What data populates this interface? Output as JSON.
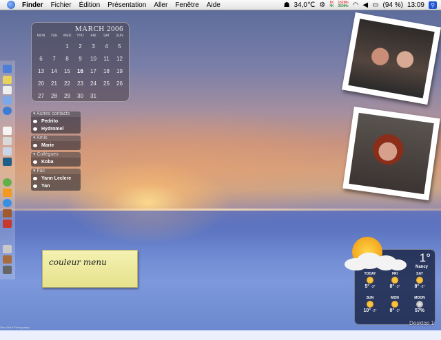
{
  "menubar": {
    "items": [
      "Finder",
      "Fichier",
      "Édition",
      "Présentation",
      "Aller",
      "Fenêtre",
      "Aide"
    ],
    "temperature": "34,0℃",
    "net_up": "1K",
    "net_down": "4K",
    "mem_up": "162Mo",
    "mem_down": "350Mo",
    "battery": "(94 %)",
    "clock": "13:09"
  },
  "calendar": {
    "month": "MARCH 2006",
    "weekdays": [
      "MON",
      "TUE",
      "WED",
      "THU",
      "FRI",
      "SAT",
      "SUN"
    ],
    "today": "16",
    "weeks": [
      [
        "",
        "",
        "1",
        "2",
        "3",
        "4",
        "5"
      ],
      [
        "6",
        "7",
        "8",
        "9",
        "10",
        "11",
        "12"
      ],
      [
        "13",
        "14",
        "15",
        "16",
        "17",
        "18",
        "19"
      ],
      [
        "20",
        "21",
        "22",
        "23",
        "24",
        "25",
        "26"
      ],
      [
        "27",
        "28",
        "29",
        "30",
        "31",
        "",
        ""
      ]
    ]
  },
  "contacts": {
    "groups": [
      {
        "name": "Autres contacts",
        "members": [
          "Pedrito",
          "Hydromel"
        ]
      },
      {
        "name": "Amis",
        "members": [
          "Marie"
        ]
      },
      {
        "name": "Collègues",
        "members": [
          "Koba"
        ]
      },
      {
        "name": "Fac",
        "members": [
          "Yann Leclere",
          "Yan"
        ]
      }
    ]
  },
  "sticky": {
    "text": "couleur menu"
  },
  "weather": {
    "temperature": "1°",
    "city": "Nancy",
    "row1": [
      {
        "day": "TODAY",
        "high": "5°",
        "low": "-3°"
      },
      {
        "day": "FRI",
        "high": "8°",
        "low": "-3°"
      },
      {
        "day": "SAT",
        "high": "8°",
        "low": "-2°"
      }
    ],
    "row2": [
      {
        "day": "SUN",
        "high": "10°",
        "low": "-2°"
      },
      {
        "day": "MON",
        "high": "8°",
        "low": "-2°"
      },
      {
        "day": "MOON",
        "high": "57%",
        "low": ""
      }
    ]
  },
  "desktop": {
    "label": "Desktop 1",
    "credit": "Sara Ward Photography"
  },
  "colors": {
    "menubar": "#e6e6e6",
    "weather_bg": "#1e2a4a",
    "sticky": "#eeea9e"
  }
}
